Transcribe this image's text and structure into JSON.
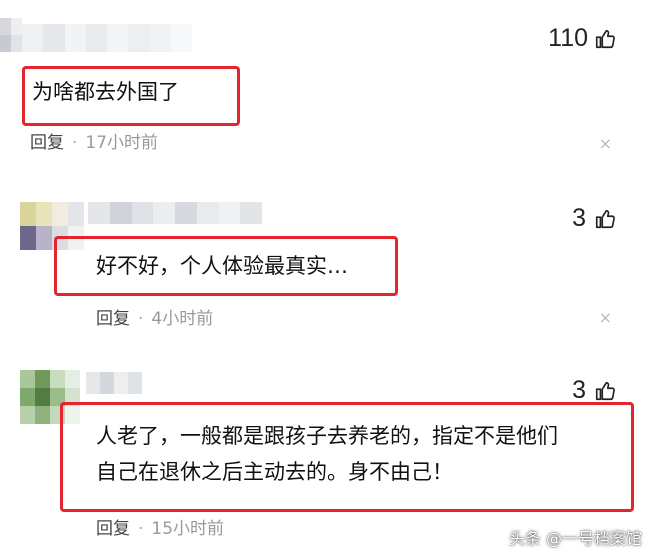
{
  "comments": [
    {
      "text": "为啥都去外国了",
      "likes": "110",
      "reply_label": "回复",
      "dot": "·",
      "time": "17小时前",
      "close": "×"
    },
    {
      "text": "好不好，个人体验最真实…",
      "likes": "3",
      "reply_label": "回复",
      "dot": "·",
      "time": "4小时前",
      "close": "×"
    },
    {
      "text_line1": "人老了，一般都是跟孩子去养老的，指定不是他们",
      "text_line2": "自己在退休之后主动去的。身不由己！",
      "likes": "3",
      "reply_label": "回复",
      "dot": "·",
      "time": "15小时前"
    }
  ],
  "watermark": "头条 @一号档案馆",
  "colors": {
    "highlight": "#e3262c",
    "meta": "#999999"
  },
  "icons": [
    "thumbs-up-icon",
    "close-icon"
  ]
}
